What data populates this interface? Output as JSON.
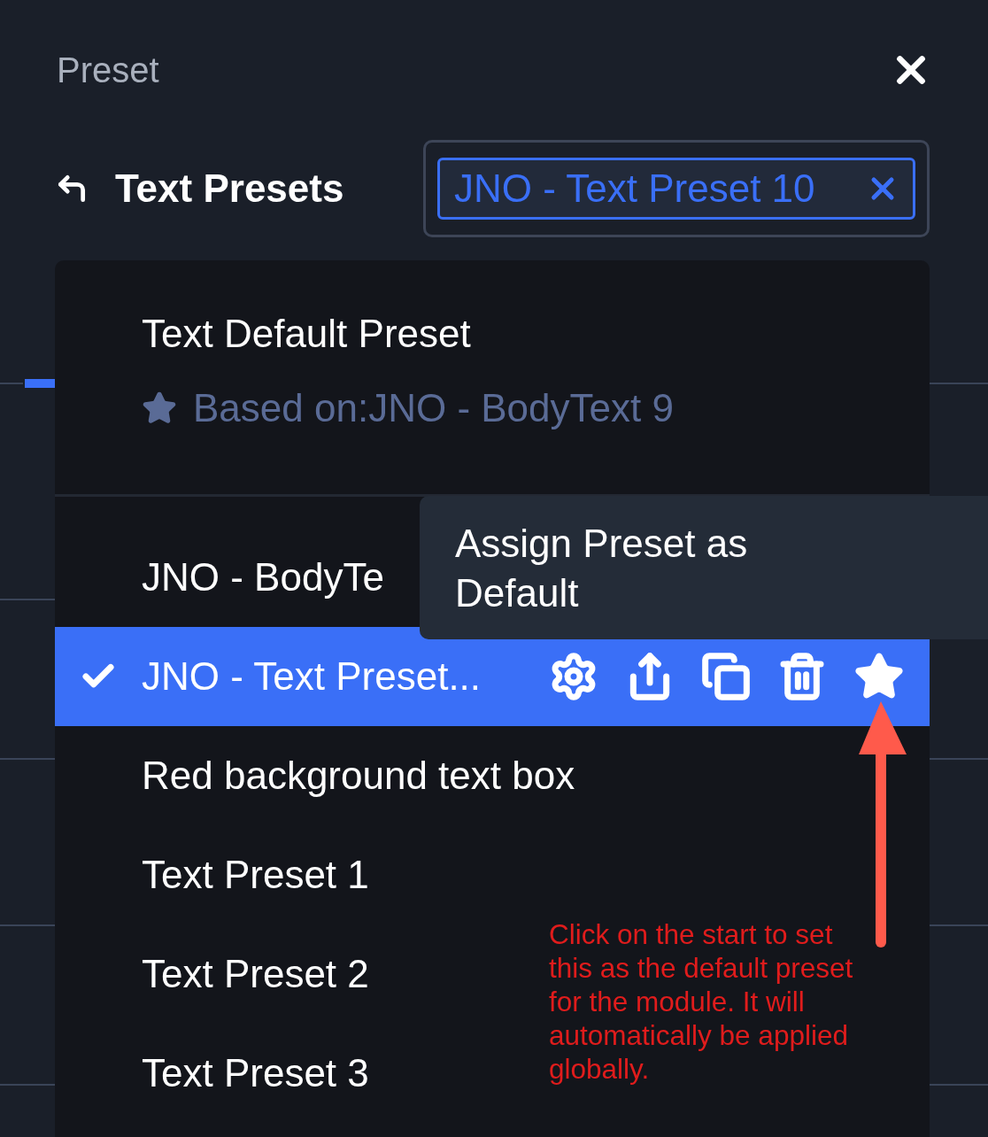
{
  "header": {
    "title": "Preset"
  },
  "toolbar": {
    "back_label": "Text Presets",
    "selected_chip": {
      "label": "JNO - Text Preset 10"
    }
  },
  "dropdown": {
    "default_preset": {
      "title": "Text Default Preset",
      "based_on": "Based on:JNO - BodyText 9"
    },
    "items": [
      {
        "label": "JNO - BodyTe",
        "selected": false
      },
      {
        "label": "JNO - Text Preset...",
        "selected": true
      },
      {
        "label": "Red background text box",
        "selected": false
      },
      {
        "label": "Text Preset 1",
        "selected": false
      },
      {
        "label": "Text Preset 2",
        "selected": false
      },
      {
        "label": "Text Preset 3",
        "selected": false
      }
    ]
  },
  "tooltip": {
    "text": "Assign Preset as Default"
  },
  "annotation": {
    "text": "Click on the start to set this as the default preset for the module.  It will automatically be applied globally."
  }
}
